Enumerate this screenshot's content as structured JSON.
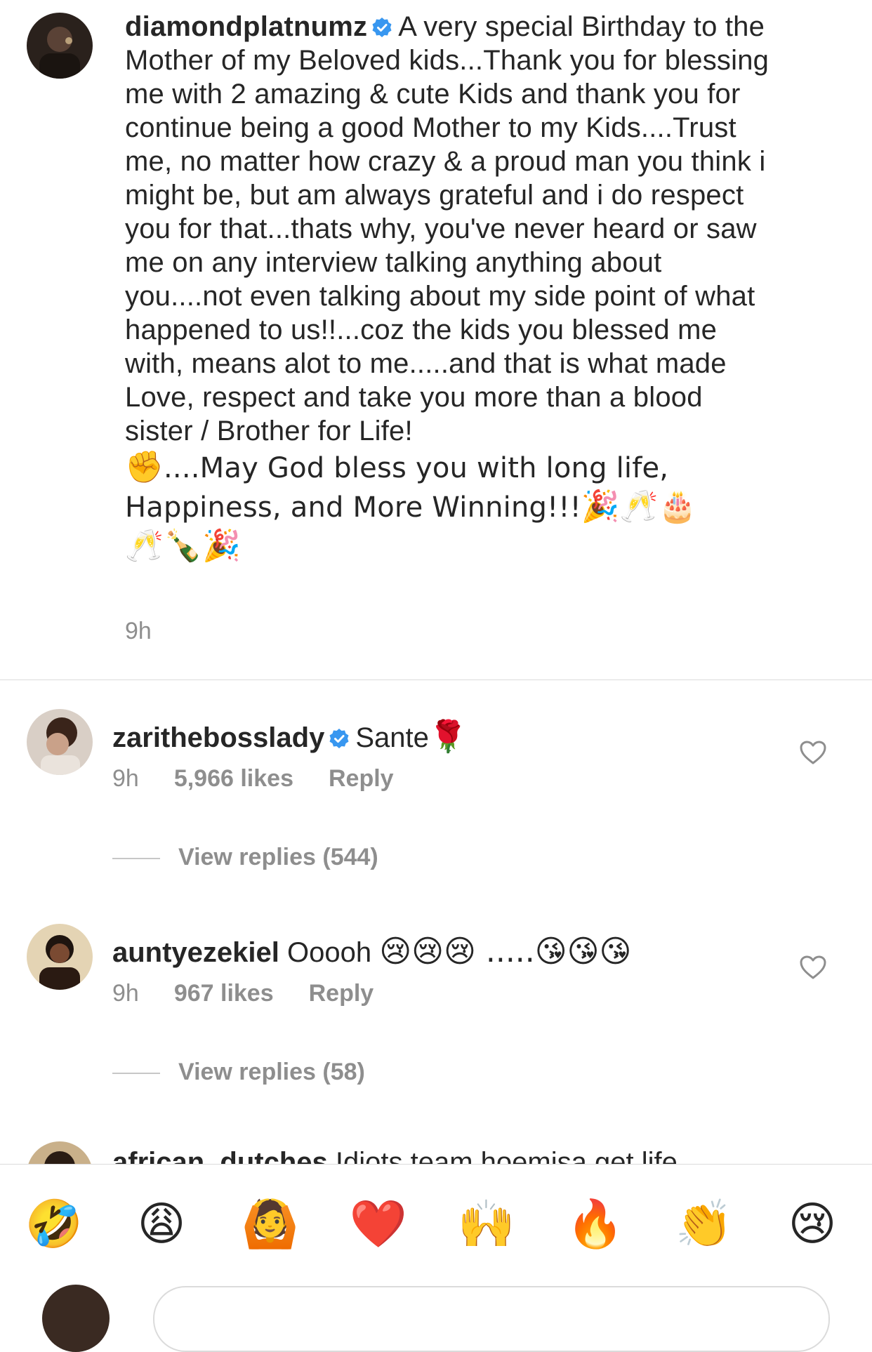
{
  "caption": {
    "username": "diamondplatnumz",
    "text": "A very special Birthday to the Mother of my Beloved kids...Thank you for blessing me with 2 amazing & cute Kids and thank you for continue being a good Mother to my Kids....Trust me, no matter how crazy & a proud man you think i might be, but am always grateful and i do respect you for that...thats why, you've never heard or saw me on any interview talking anything about you....not even talking about my side point of what happened to us!!...coz the kids you blessed me with, means alot to me.....and that is what made Love,  respect and take you more than a blood sister / Brother for Life!",
    "fist_emoji": "✊",
    "text_2": "....May God bless you with long life, Happiness, and More Winning!!!",
    "emojis_end": "🎉🥂🎂",
    "emojis_last_line": "🥂🍾🎉",
    "time": "9h"
  },
  "comments": [
    {
      "username": "zarithebosslady",
      "verified": true,
      "text": "Sante",
      "emoji": "🌹",
      "time": "9h",
      "likes": "5,966 likes",
      "reply_label": "Reply",
      "view_replies": "View replies (544)"
    },
    {
      "username": "auntyezekiel",
      "verified": false,
      "text": "Ooooh",
      "emoji": "😢😢😢 .....😘😘😘",
      "time": "9h",
      "likes": "967 likes",
      "reply_label": "Reply",
      "view_replies": "View replies (58)"
    },
    {
      "username": "african_dutches",
      "verified": false,
      "text": "Idiots team hoemisa  get life"
    }
  ],
  "reactions": [
    "🤣",
    "😩",
    "🙆",
    "❤️",
    "🙌",
    "🔥",
    "👏",
    "😢"
  ],
  "colors": {
    "text": "#262626",
    "muted": "#8e8e8e",
    "verified_blue": "#3897f0",
    "divider": "#dbdbdb"
  }
}
